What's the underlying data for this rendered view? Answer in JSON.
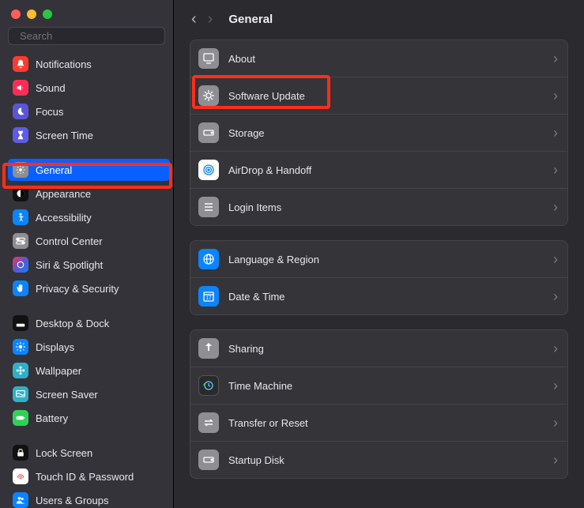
{
  "window": {
    "title": "General"
  },
  "search": {
    "placeholder": "Search"
  },
  "sidebar": {
    "items": [
      {
        "label": "Notifications",
        "icon": "bell-icon",
        "color": "bg-red"
      },
      {
        "label": "Sound",
        "icon": "speaker-icon",
        "color": "bg-pink"
      },
      {
        "label": "Focus",
        "icon": "moon-icon",
        "color": "bg-purple"
      },
      {
        "label": "Screen Time",
        "icon": "hourglass-icon",
        "color": "bg-indigo"
      }
    ],
    "group2": [
      {
        "label": "General",
        "icon": "gear-icon",
        "color": "bg-gray",
        "selected": true
      },
      {
        "label": "Appearance",
        "icon": "contrast-icon",
        "color": "bg-black"
      },
      {
        "label": "Accessibility",
        "icon": "person-icon",
        "color": "bg-blue"
      },
      {
        "label": "Control Center",
        "icon": "switches-icon",
        "color": "bg-gray"
      },
      {
        "label": "Siri & Spotlight",
        "icon": "siri-icon",
        "color": "bg-grad"
      },
      {
        "label": "Privacy & Security",
        "icon": "hand-icon",
        "color": "bg-blue"
      }
    ],
    "group3": [
      {
        "label": "Desktop & Dock",
        "icon": "dock-icon",
        "color": "bg-black"
      },
      {
        "label": "Displays",
        "icon": "sun-icon",
        "color": "bg-blue"
      },
      {
        "label": "Wallpaper",
        "icon": "flower-icon",
        "color": "bg-ltblue"
      },
      {
        "label": "Screen Saver",
        "icon": "wave-icon",
        "color": "bg-ltblue"
      },
      {
        "label": "Battery",
        "icon": "battery-icon",
        "color": "bg-green"
      }
    ],
    "group4": [
      {
        "label": "Lock Screen",
        "icon": "lock-icon",
        "color": "bg-black"
      },
      {
        "label": "Touch ID & Password",
        "icon": "fingerprint-icon",
        "color": "bg-red"
      },
      {
        "label": "Users & Groups",
        "icon": "users-icon",
        "color": "bg-blue"
      }
    ]
  },
  "main": {
    "groups": [
      [
        {
          "label": "About",
          "icon": "mac-icon",
          "iconBg": "#8e8e93"
        },
        {
          "label": "Software Update",
          "icon": "gear-badge-icon",
          "iconBg": "#8e8e93"
        },
        {
          "label": "Storage",
          "icon": "disk-icon",
          "iconBg": "#8e8e93"
        },
        {
          "label": "AirDrop & Handoff",
          "icon": "airdrop-icon",
          "iconBg": "#ffffff"
        },
        {
          "label": "Login Items",
          "icon": "list-icon",
          "iconBg": "#8e8e93"
        }
      ],
      [
        {
          "label": "Language & Region",
          "icon": "globe-icon",
          "iconBg": "#0a84ff"
        },
        {
          "label": "Date & Time",
          "icon": "calendar-icon",
          "iconBg": "#0a84ff"
        }
      ],
      [
        {
          "label": "Sharing",
          "icon": "share-icon",
          "iconBg": "#8e8e93"
        },
        {
          "label": "Time Machine",
          "icon": "clock-swirl-icon",
          "iconBg": "#2a2a2c"
        },
        {
          "label": "Transfer or Reset",
          "icon": "arrows-icon",
          "iconBg": "#8e8e93"
        },
        {
          "label": "Startup Disk",
          "icon": "disk-icon",
          "iconBg": "#8e8e93"
        }
      ]
    ]
  }
}
